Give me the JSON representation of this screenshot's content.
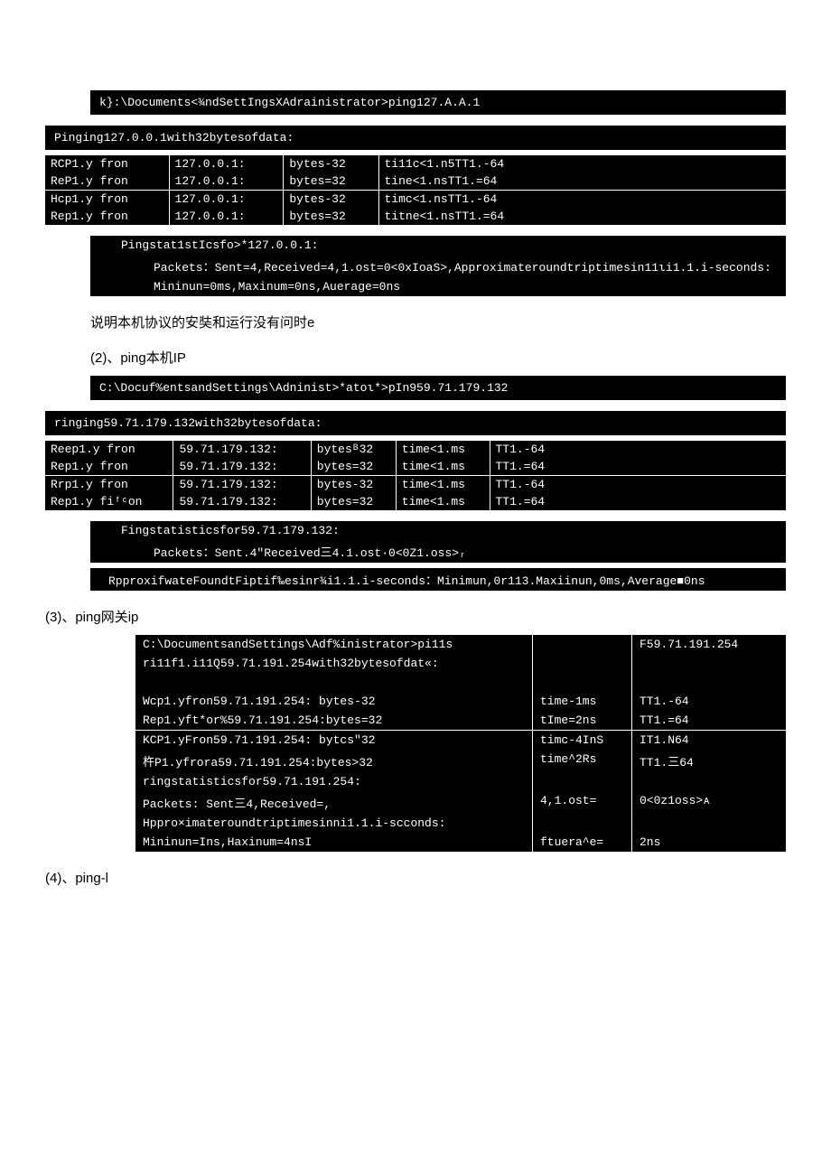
{
  "block1": {
    "cmd": "k}:\\Documents<¾ndSettIngsXAdrainistrator>ping127.A.A.1",
    "hdr": "Pinging127.0.0.1with32bytesofdata:",
    "rows": [
      [
        "RCP1.y fron",
        "127.0.0.1:",
        "bytes-32",
        "ti11c<1.n5TT1.-64"
      ],
      [
        "ReP1.y fron",
        "127.0.0.1:",
        "bytes=32",
        "tine<1.nsTT1.=64"
      ],
      [
        "Hcp1.y fron",
        "127.0.0.1:",
        "bytes-32",
        "timc<1.nsTT1.-64"
      ],
      [
        "Rep1.y fron",
        "127.0.0.1:",
        "bytes=32",
        "titne<1.nsTT1.=64"
      ]
    ],
    "stat1": "Pingstat1stIcsfo>*127.0.0.1:",
    "stat2": "Packets：Sent=4,Received=4,1.ost=0<0xIoaS>,Approximateroundtriptimesin11ιi1.1.i-seconds:",
    "stat3": "Mininun=0ms,Maxinum=0ns,Auerage=0ns"
  },
  "cap1": "说明本机协议的安奘和运行没有问时e",
  "h2": "(2)、ping本机IP",
  "block2": {
    "cmd": "C:\\Docuf%entsandSettings\\Adninist>*atoι*>pIn959.71.179.132",
    "hdr": "ringing59.71.179.132with32bytesofdata:",
    "rows": [
      [
        "Reep1.y fron",
        "59.71.179.132:",
        "bytesᴮ32",
        "time<1.ms",
        "TT1.-64"
      ],
      [
        "Rep1.y fron",
        "59.71.179.132:",
        "bytes=32",
        "time<1.ms",
        "TT1.=64"
      ],
      [
        "Rrp1.y fron",
        "59.71.179.132:",
        "bytes-32",
        "time<1.ms",
        "TT1.-64"
      ],
      [
        "Rep1.y fiᶠᶜon",
        "59.71.179.132:",
        "bytes=32",
        "time<1.ms",
        "TT1.=64"
      ]
    ],
    "stat1": "Fingstatisticsfor59.71.179.132:",
    "stat2": "Packets：Sent.4\"Received三4.1.ost·0<0Z1.oss>ᵣ",
    "stat3": "RpproxifwateFoundtFiptif‰esinr¾i1.1.i-seconds：Minimun,0r113.Maxiinun,0ms,Average■0ns"
  },
  "h3": "(3)、ping网关ip",
  "block3": {
    "cmd": "C:\\DocumentsandSettings\\Adf%inistrator>pi11s",
    "cmdR": "F59.71.191.254",
    "hdr": "ri11f1.i11Q59.71.191.254with32bytesofdat«:",
    "rows": [
      [
        "Wcp1.yfron59.71.191.254: bytes-32",
        "time-1ms",
        "TT1.-64"
      ],
      [
        "Rep1.yft*or%59.71.191.254:bytes=32",
        "tIme=2ns",
        "TT1.=64"
      ],
      [
        "KCP1.yFron59.71.191.254: bytcs\"32",
        "timc-4InS",
        "IT1.N64"
      ],
      [
        "杵P1.yfrora59.71.191.254:bytes>32",
        "time^2Rs",
        "TT1.三64"
      ]
    ],
    "stat1": "ringstatisticsfor59.71.191.254:",
    "stat2a": "    Packets: Sent三4,Received=,",
    "stat2b": "4,1.ost=",
    "stat2c": "0<0z1oss>ᴀ",
    "stat3": "Hppro×imateroundtriptimesinni1.1.i-scconds:",
    "stat4a": "    Mininun=Ins,Haxinum=4nsI",
    "stat4b": "ftuera^e=",
    "stat4c": "2ns"
  },
  "h4": "(4)、ping-l"
}
